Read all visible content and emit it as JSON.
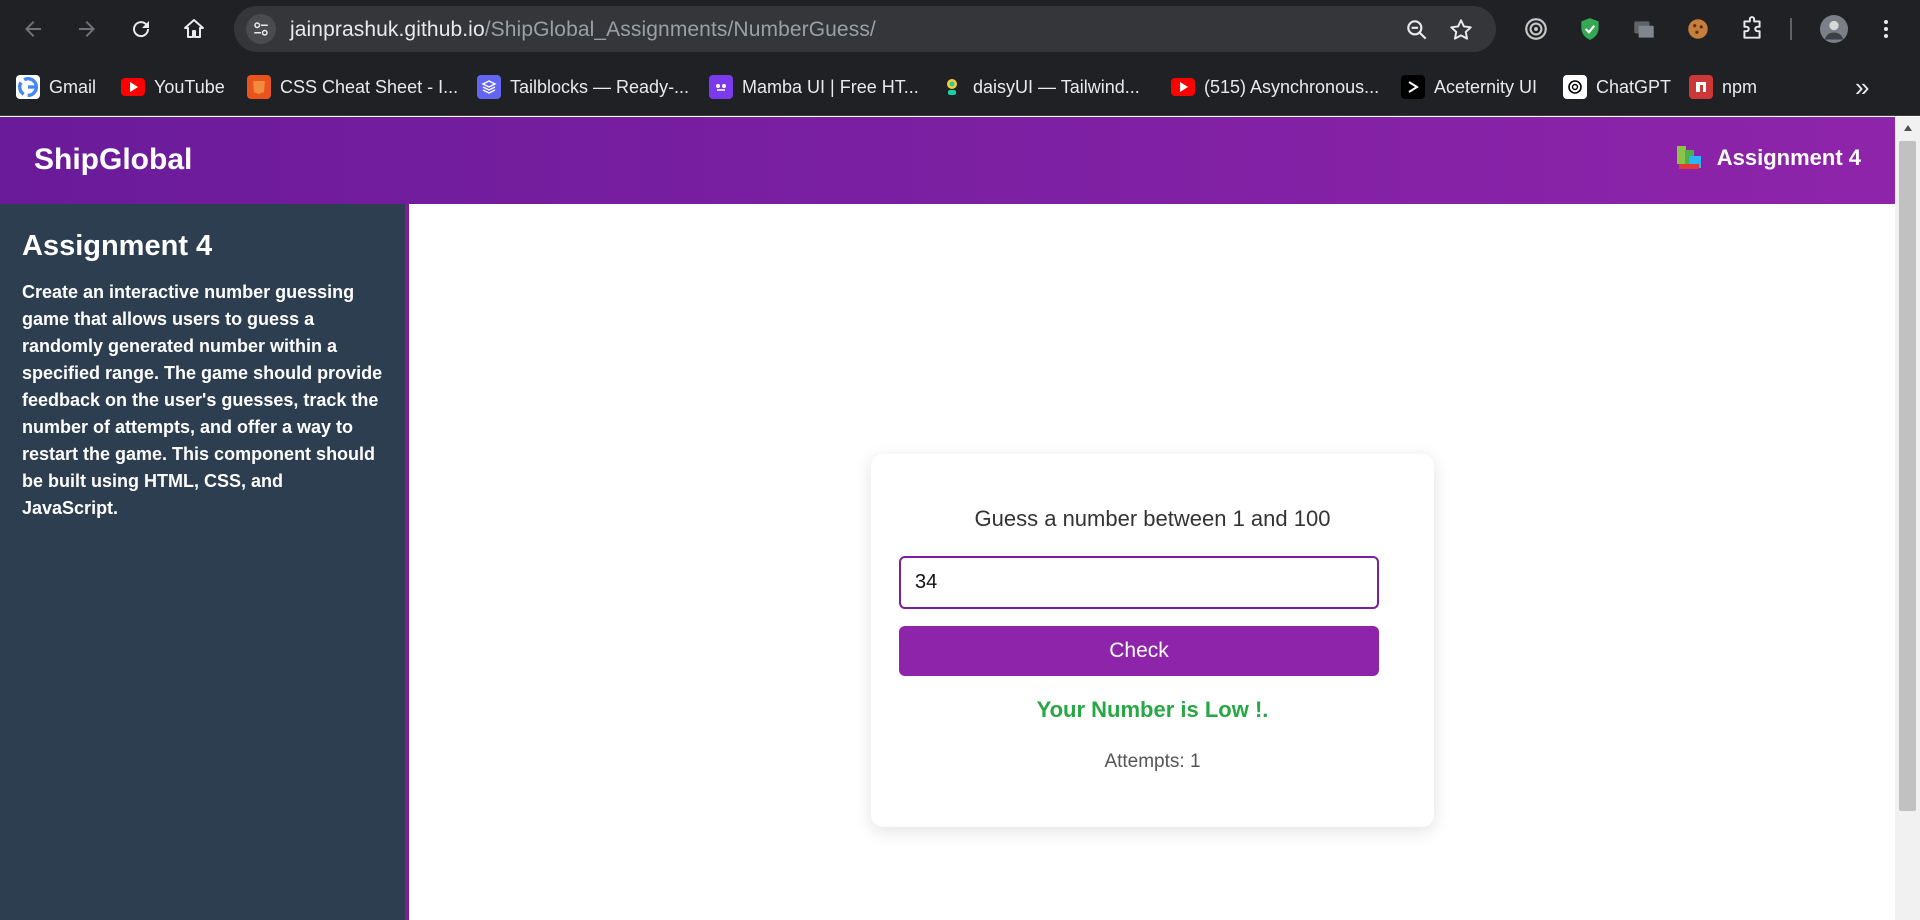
{
  "browser": {
    "url_domain": "jainprashuk.github.io",
    "url_path": "/ShipGlobal_Assignments/NumberGuess/",
    "bookmarks": [
      {
        "label": "Gmail",
        "icon": "gmail-icon",
        "color": "#ffffff"
      },
      {
        "label": "YouTube",
        "icon": "youtube-icon",
        "color": "#ff0000"
      },
      {
        "label": "CSS Cheat Sheet - I...",
        "icon": "css-cheat-sheet-icon",
        "color": "#e8541e"
      },
      {
        "label": "Tailblocks — Ready-...",
        "icon": "tailblocks-icon",
        "color": "#6366f1"
      },
      {
        "label": "Mamba UI | Free HT...",
        "icon": "mamba-ui-icon",
        "color": "#7c3aed"
      },
      {
        "label": "daisyUI — Tailwind...",
        "icon": "daisyui-icon",
        "color": "#1ad1a5"
      },
      {
        "label": "(515) Asynchronous...",
        "icon": "youtube-icon",
        "color": "#ff0000"
      },
      {
        "label": "Aceternity UI",
        "icon": "aceternity-icon",
        "color": "#000000"
      },
      {
        "label": "ChatGPT",
        "icon": "chatgpt-icon",
        "color": "#ffffff"
      },
      {
        "label": "npm",
        "icon": "npm-icon",
        "color": "#cb3837"
      }
    ],
    "more_bookmarks": "»"
  },
  "header": {
    "brand": "ShipGlobal",
    "nav_label": "Assignment 4"
  },
  "sidebar": {
    "title": "Assignment 4",
    "description": "Create an interactive number guessing game that allows users to guess a randomly generated number within a specified range. The game should provide feedback on the user's guesses, track the number of attempts, and offer a way to restart the game. This component should be built using HTML, CSS, and JavaScript."
  },
  "game": {
    "prompt": "Guess a number between 1 and 100",
    "input_value": "34",
    "button_label": "Check",
    "feedback": "Your Number is Low !.",
    "attempts": "Attempts: 1"
  },
  "colors": {
    "header_gradient_start": "#6a1b9a",
    "header_gradient_end": "#8e24aa",
    "sidebar_bg": "#2c3e50",
    "accent": "#8e24aa",
    "feedback_green": "#28a745"
  }
}
